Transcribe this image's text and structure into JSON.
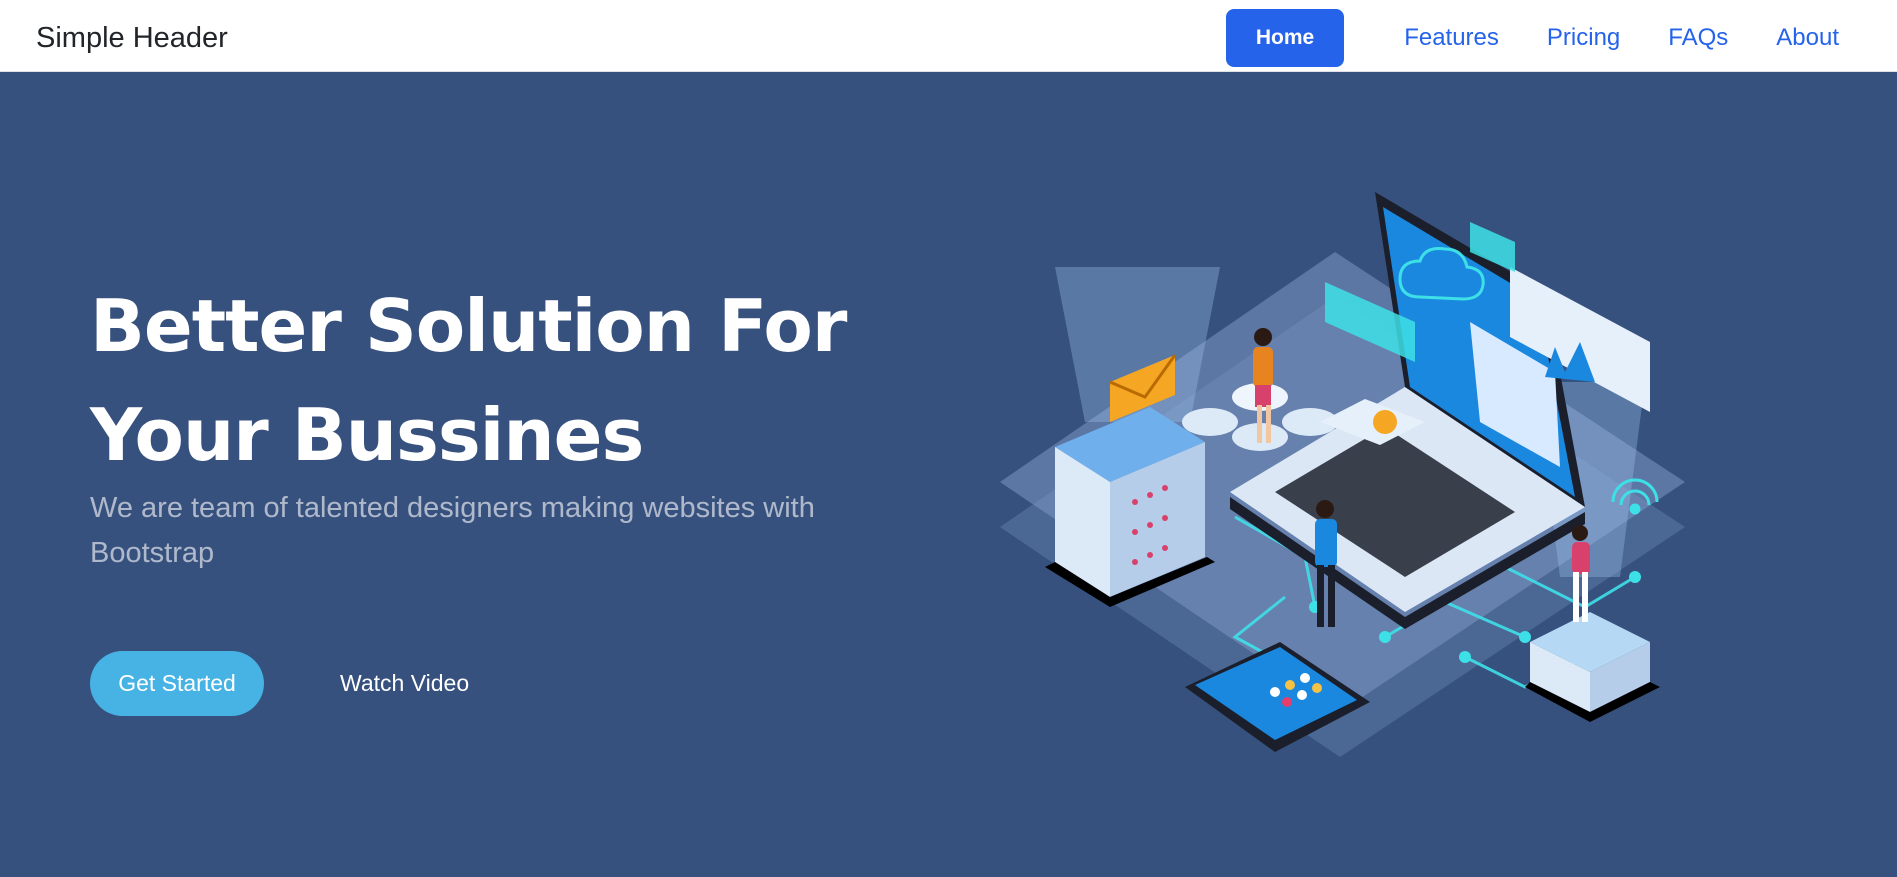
{
  "header": {
    "brand": "Simple Header",
    "nav": [
      {
        "label": "Home",
        "active": true
      },
      {
        "label": "Features",
        "active": false
      },
      {
        "label": "Pricing",
        "active": false
      },
      {
        "label": "FAQs",
        "active": false
      },
      {
        "label": "About",
        "active": false
      }
    ]
  },
  "hero": {
    "title_line1": "Better Solution For",
    "title_line2": "Your Bussines",
    "subtitle": "We are team of talented designers making websites with Bootstrap",
    "primary_button": "Get Started",
    "secondary_button": "Watch Video",
    "illustration": "isometric-tech-illustration"
  },
  "colors": {
    "hero_bg": "#37517e",
    "nav_accent": "#2563eb",
    "cta": "#47b2e4",
    "illustration_cyan": "#3ee0e8"
  }
}
